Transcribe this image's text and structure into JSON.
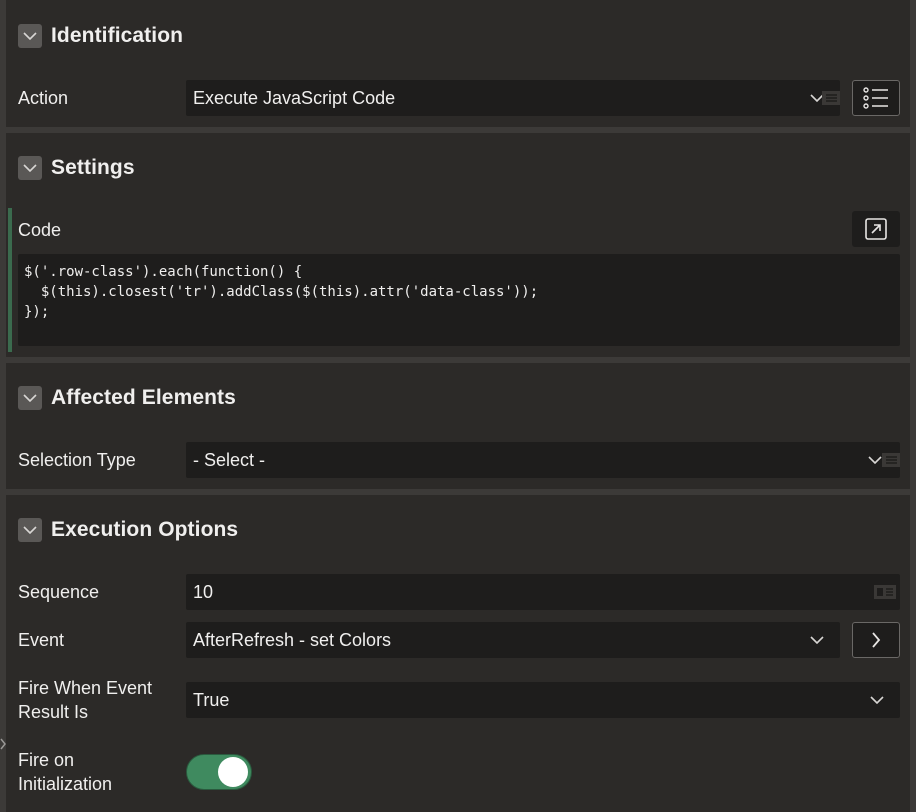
{
  "sections": {
    "identification": {
      "title": "Identification"
    },
    "settings": {
      "title": "Settings"
    },
    "affected": {
      "title": "Affected Elements"
    },
    "execution": {
      "title": "Execution Options"
    }
  },
  "identification": {
    "action_label": "Action",
    "action_value": "Execute JavaScript Code"
  },
  "settings": {
    "code_label": "Code",
    "code_value": "$('.row-class').each(function() {\n  $(this).closest('tr').addClass($(this).attr('data-class'));\n});"
  },
  "affected": {
    "selection_type_label": "Selection Type",
    "selection_type_value": "- Select -"
  },
  "execution": {
    "sequence_label": "Sequence",
    "sequence_value": "10",
    "event_label": "Event",
    "event_value": "AfterRefresh - set Colors",
    "fire_when_label_1": "Fire When Event",
    "fire_when_label_2": "Result Is",
    "fire_when_value": "True",
    "fire_init_label_1": "Fire on",
    "fire_init_label_2": "Initialization",
    "fire_init_on": true
  },
  "colors": {
    "background": "#2c2a28",
    "field": "#1e1d1c",
    "accent_green": "#3f8a5f"
  },
  "icons": [
    "chevron-down-icon",
    "list-icon",
    "expand-icon",
    "chevron-right-icon",
    "collapse-icon"
  ]
}
